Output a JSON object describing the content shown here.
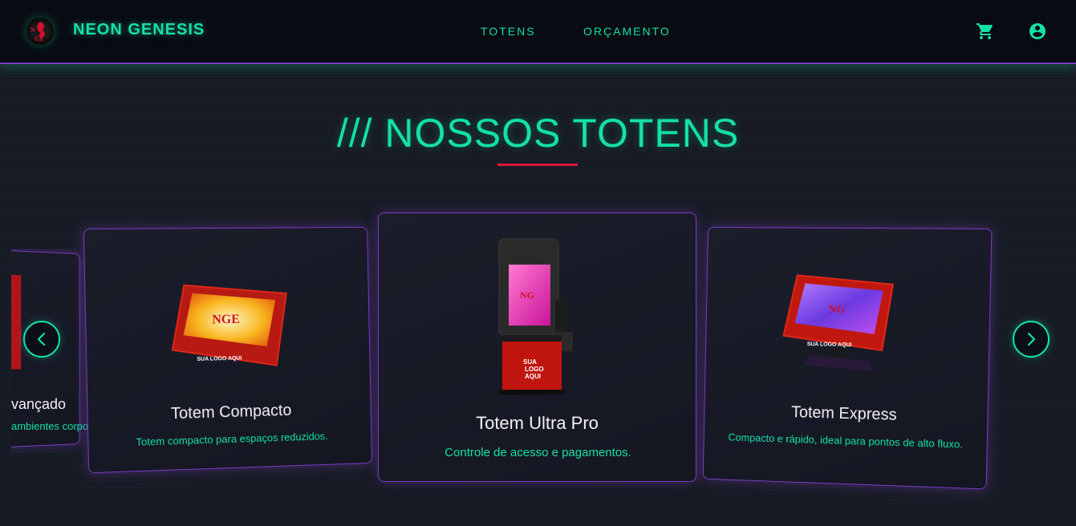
{
  "header": {
    "brand": "NEON GENESIS",
    "logo_text": "NGE",
    "nav": [
      {
        "label": "TOTENS"
      },
      {
        "label": "ORÇAMENTO"
      }
    ],
    "icons": [
      "cart-icon",
      "account-icon"
    ]
  },
  "section": {
    "title": "/// NOSSOS TOTENS"
  },
  "cards": [
    {
      "title": "Totem Avançado",
      "title_visible": "vançado",
      "desc_visible": "ambientes corpo"
    },
    {
      "title": "Totem Compacto",
      "desc": "Totem compacto para espaços reduzidos.",
      "logo_text": "SUA LOGO AQUI"
    },
    {
      "title": "Totem Ultra Pro",
      "desc": "Controle de acesso e pagamentos.",
      "logo_text_1": "SUA",
      "logo_text_2": "LOGO",
      "logo_text_3": "AQUI"
    },
    {
      "title": "Totem Express",
      "desc": "Compacto e rápido, ideal para pontos de alto fluxo.",
      "logo_text": "SUA LOGO AQUI"
    }
  ],
  "carousel": {
    "prev_icon": "chevron-left-icon",
    "next_icon": "chevron-right-icon"
  },
  "colors": {
    "accent": "#14e0a6",
    "border_purple": "#7a3cc0",
    "underline_red": "#e0143a",
    "background": "#161a24"
  }
}
